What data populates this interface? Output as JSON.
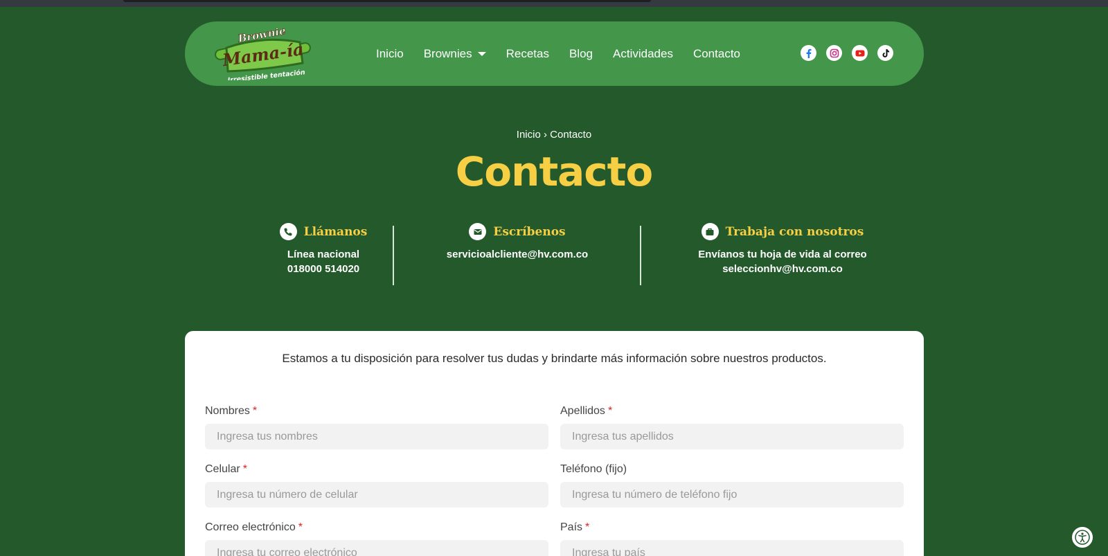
{
  "logo": {
    "top": "Brownie",
    "main": "Mama-ía",
    "tagline": "Irresistible tentación"
  },
  "nav": {
    "items": [
      {
        "label": "Inicio"
      },
      {
        "label": "Brownies"
      },
      {
        "label": "Recetas"
      },
      {
        "label": "Blog"
      },
      {
        "label": "Actividades"
      },
      {
        "label": "Contacto"
      }
    ]
  },
  "socials": [
    "facebook-icon",
    "instagram-icon",
    "youtube-icon",
    "tiktok-icon"
  ],
  "breadcrumb": {
    "home": "Inicio",
    "sep": "›",
    "current": "Contacto"
  },
  "page_title": "Contacto",
  "contact": {
    "call": {
      "title": "Llámanos",
      "line1": "Línea nacional",
      "line2": "018000 514020"
    },
    "write": {
      "title": "Escríbenos",
      "line1": "servicioalcliente@hv.com.co"
    },
    "work": {
      "title": "Trabaja con nosotros",
      "line1": "Envíanos tu hoja de vida al correo",
      "line2": "seleccionhv@hv.com.co"
    }
  },
  "form": {
    "intro": "Estamos a tu disposición para resolver tus dudas y brindarte más información sobre nuestros productos.",
    "required_mark": "*",
    "fields": {
      "nombres": {
        "label": "Nombres",
        "placeholder": "Ingresa tus nombres"
      },
      "apellidos": {
        "label": "Apellidos",
        "placeholder": "Ingresa tus apellidos"
      },
      "celular": {
        "label": "Celular",
        "placeholder": "Ingresa tu número de celular"
      },
      "telefono": {
        "label": "Teléfono (fijo)",
        "placeholder": "Ingresa tu número de teléfono fijo"
      },
      "correo": {
        "label": "Correo electrónico",
        "placeholder": "Ingresa tu correo electrónico"
      },
      "pais": {
        "label": "País",
        "placeholder": "Ingresa tu país"
      }
    }
  },
  "colors": {
    "background": "#245a2b",
    "header": "#43964a",
    "accent": "#f6cf45"
  }
}
